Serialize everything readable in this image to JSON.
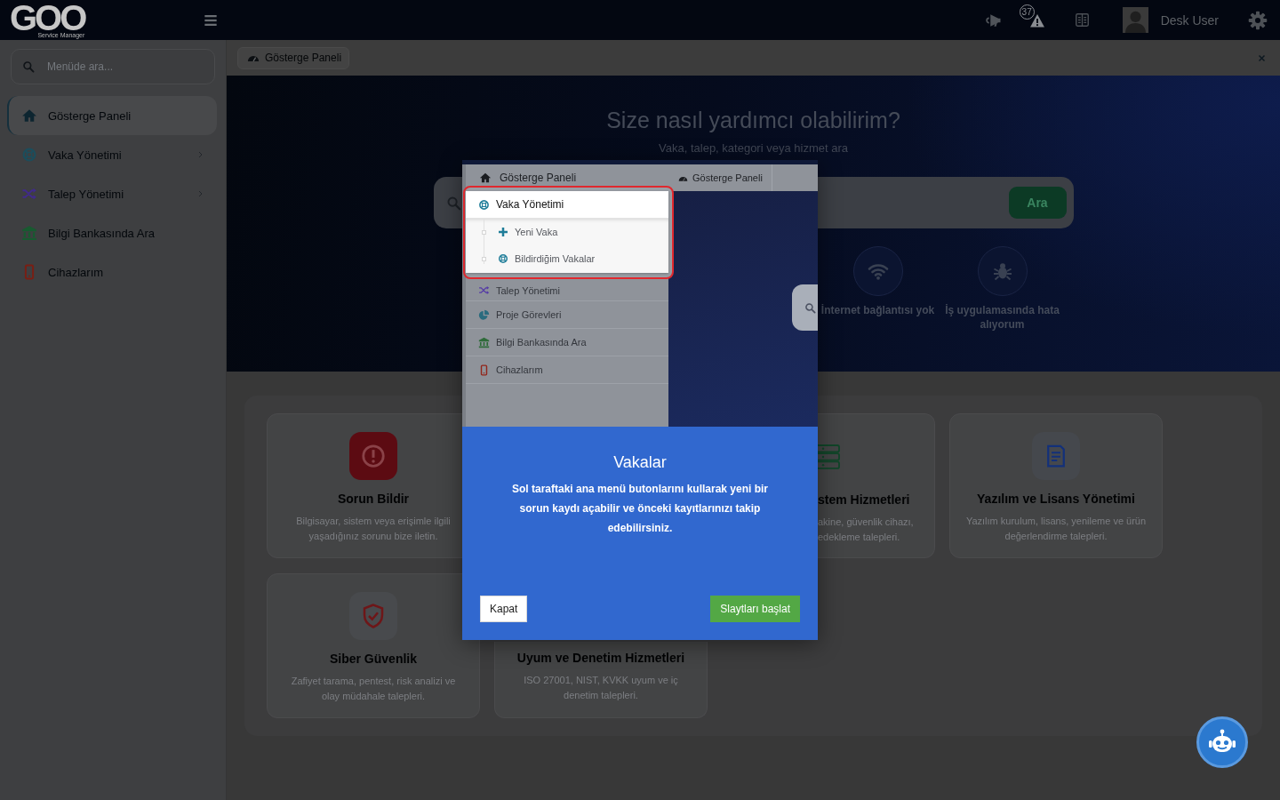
{
  "topbar": {
    "logo": {
      "mark": "GOO",
      "tagline": "Service Manager"
    },
    "alert_count": "37",
    "user_name": "Desk User"
  },
  "sidebar": {
    "search": {
      "placeholder": "Menüde ara..."
    },
    "items": [
      {
        "label": "Gösterge Paneli",
        "selected": true,
        "has_submenu": false
      },
      {
        "label": "Vaka Yönetimi",
        "selected": false,
        "has_submenu": true
      },
      {
        "label": "Talep Yönetimi",
        "selected": false,
        "has_submenu": true
      },
      {
        "label": "Bilgi Bankasında Ara",
        "selected": false,
        "has_submenu": false
      },
      {
        "label": "Cihazlarım",
        "selected": false,
        "has_submenu": false
      }
    ]
  },
  "content_header": {
    "tab": {
      "label": "Gösterge Paneli"
    }
  },
  "hero": {
    "title": "Size nasıl yardımcı olabilirim?",
    "subtitle": "Vaka, talep, kategori veya hizmet ara",
    "search": {
      "button": "Ara"
    },
    "quick_links": [
      {
        "label": "İnternet bağlantısı yok"
      },
      {
        "label": "İş uygulamasında hata alıyorum"
      }
    ]
  },
  "services": {
    "rows": [
      {
        "cards": [
          {
            "kind": "full",
            "title": "Sorun Bildir",
            "description": "Bilgisayar, sistem veya erişimle ilgili yaşadığınız sorunu bize iletin."
          },
          {
            "kind": "left_cut",
            "title": "stem Hizmetleri",
            "description": "akine, güvenlik cihazı, edekleme talepleri."
          },
          {
            "kind": "full",
            "title": "Yazılım ve Lisans Yönetimi",
            "description": "Yazılım kurulum, lisans, yenileme ve ürün değerlendirme talepleri."
          }
        ]
      },
      {
        "cards": [
          {
            "kind": "full",
            "title": "Siber Güvenlik",
            "description": "Zafiyet tarama, pentest, risk analizi ve olay müdahale talepleri."
          },
          {
            "kind": "top_cut",
            "title": "Uyum ve Denetim Hizmetleri",
            "description": "ISO 27001, NIST, KVKK uyum ve iç denetim talepleri."
          }
        ]
      }
    ]
  },
  "tour": {
    "preview": {
      "sidebar_header": "Gösterge Paneli",
      "tab": "Gösterge Paneli",
      "items": [
        {
          "label": "Vaka Yönetimi",
          "highlighted": true,
          "children": [
            {
              "label": "Yeni Vaka"
            },
            {
              "label": "Bildirdiğim Vakalar"
            }
          ]
        },
        {
          "label": "Talep Yönetimi",
          "highlighted": false
        },
        {
          "label": "Proje Görevleri",
          "highlighted": false
        },
        {
          "label": "Bilgi Bankasında Ara",
          "highlighted": false
        },
        {
          "label": "Cihazlarım",
          "highlighted": false
        }
      ]
    },
    "title": "Vakalar",
    "text": "Sol taraftaki ana menü butonlarını kullarak yeni bir sorun kaydı açabilir ve önceki kayıtlarınızı takip edebilirsiniz.",
    "buttons": [
      {
        "label": "Kapat",
        "kind": "secondary"
      },
      {
        "label": "Slaytları başlat",
        "kind": "primary"
      }
    ]
  }
}
